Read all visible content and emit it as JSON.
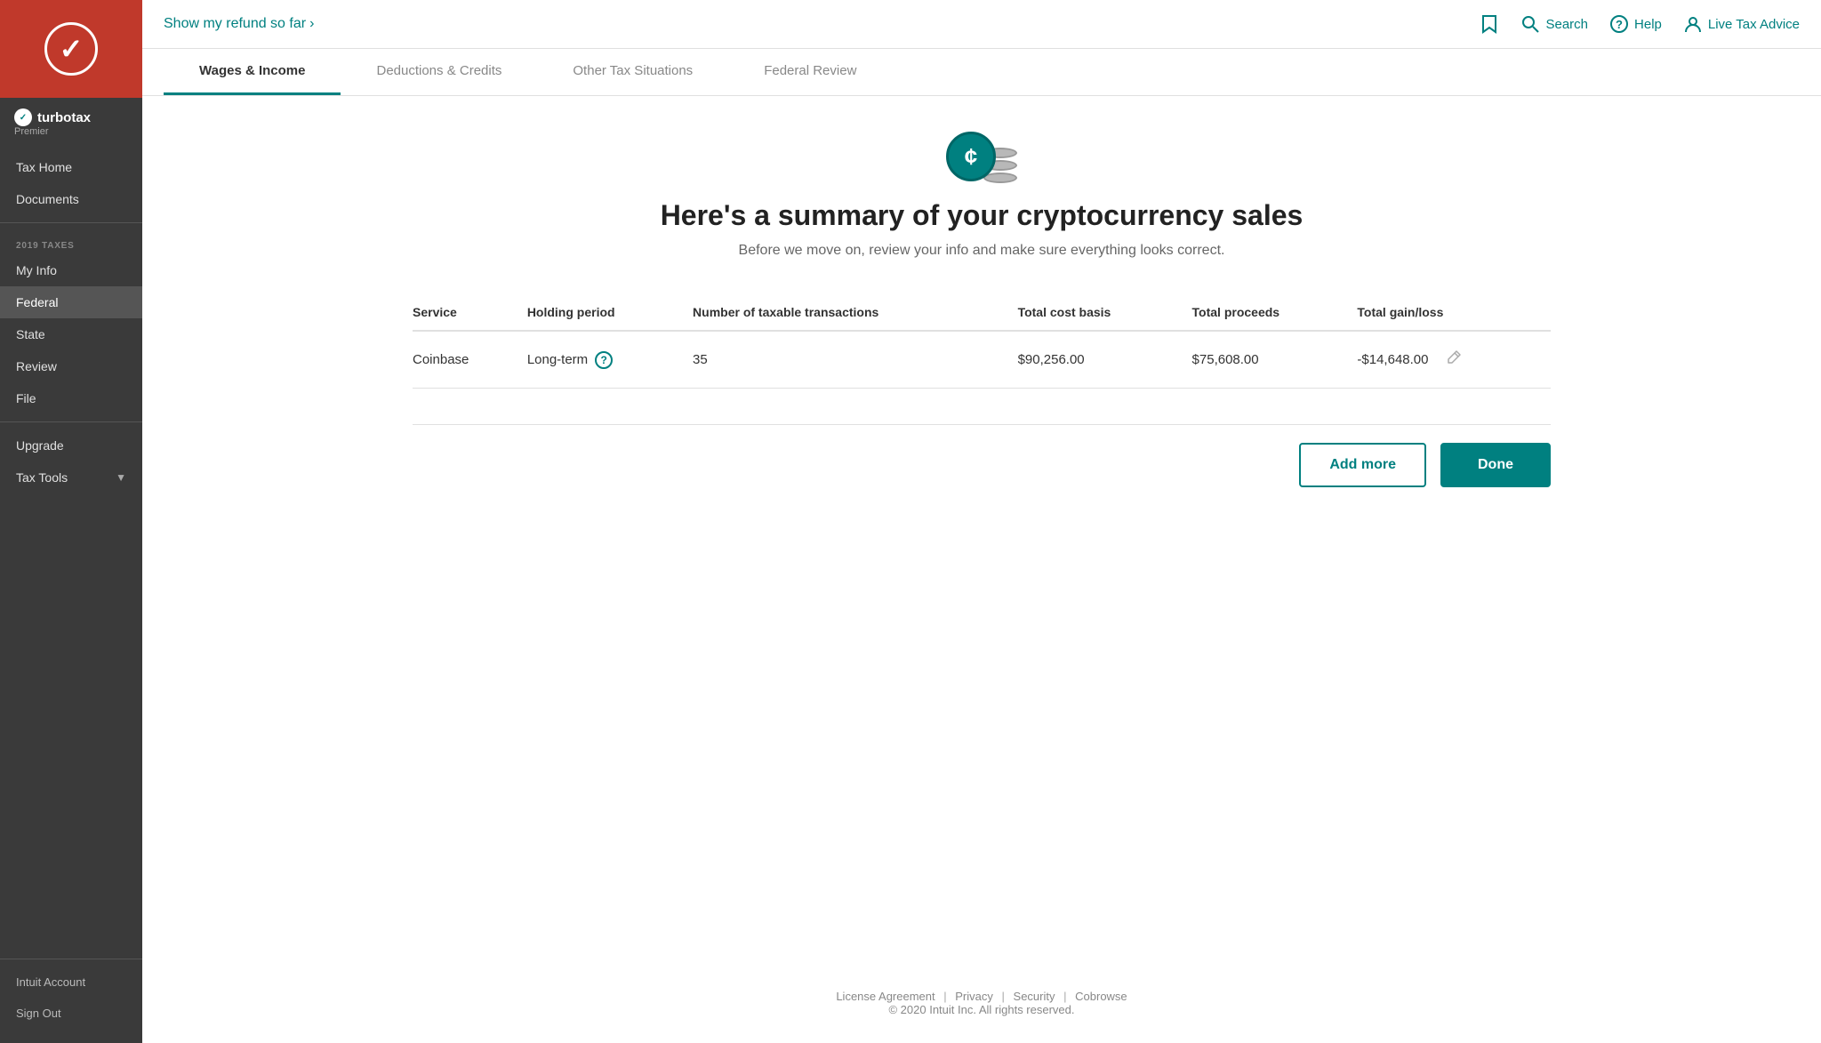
{
  "sidebar": {
    "brand": {
      "name": "turbotax",
      "tier": "Premier"
    },
    "top_nav": [
      {
        "id": "tax-home",
        "label": "Tax Home",
        "active": false
      },
      {
        "id": "documents",
        "label": "Documents",
        "active": false
      }
    ],
    "section_label": "2019 TAXES",
    "tax_nav": [
      {
        "id": "my-info",
        "label": "My Info",
        "active": false
      },
      {
        "id": "federal",
        "label": "Federal",
        "active": true
      },
      {
        "id": "state",
        "label": "State",
        "active": false
      },
      {
        "id": "review",
        "label": "Review",
        "active": false
      },
      {
        "id": "file",
        "label": "File",
        "active": false
      }
    ],
    "tools_nav": [
      {
        "id": "upgrade",
        "label": "Upgrade",
        "active": false
      },
      {
        "id": "tax-tools",
        "label": "Tax Tools",
        "has_chevron": true
      }
    ],
    "bottom_nav": [
      {
        "id": "intuit-account",
        "label": "Intuit Account"
      },
      {
        "id": "sign-out",
        "label": "Sign Out"
      }
    ]
  },
  "header": {
    "refund_link": "Show my refund so far",
    "search_label": "Search",
    "help_label": "Help",
    "live_tax_advice_label": "Live Tax Advice"
  },
  "nav_tabs": [
    {
      "id": "wages-income",
      "label": "Wages & Income",
      "active": true
    },
    {
      "id": "deductions-credits",
      "label": "Deductions & Credits",
      "active": false
    },
    {
      "id": "other-tax-situations",
      "label": "Other Tax Situations",
      "active": false
    },
    {
      "id": "federal-review",
      "label": "Federal Review",
      "active": false
    }
  ],
  "page": {
    "title": "Here's a summary of your cryptocurrency sales",
    "subtitle": "Before we move on, review your info and make sure everything looks correct.",
    "table": {
      "headers": [
        "Service",
        "Holding period",
        "Number of taxable transactions",
        "Total cost basis",
        "Total proceeds",
        "Total gain/loss"
      ],
      "rows": [
        {
          "service": "Coinbase",
          "holding_period": "Long-term",
          "num_transactions": "35",
          "total_cost_basis": "$90,256.00",
          "total_proceeds": "$75,608.00",
          "total_gain_loss": "-$14,648.00"
        }
      ]
    },
    "add_more_label": "Add more",
    "done_label": "Done"
  },
  "footer": {
    "links": [
      "License Agreement",
      "Privacy",
      "Security",
      "Cobrowse"
    ],
    "copyright": "© 2020 Intuit Inc. All rights reserved."
  }
}
